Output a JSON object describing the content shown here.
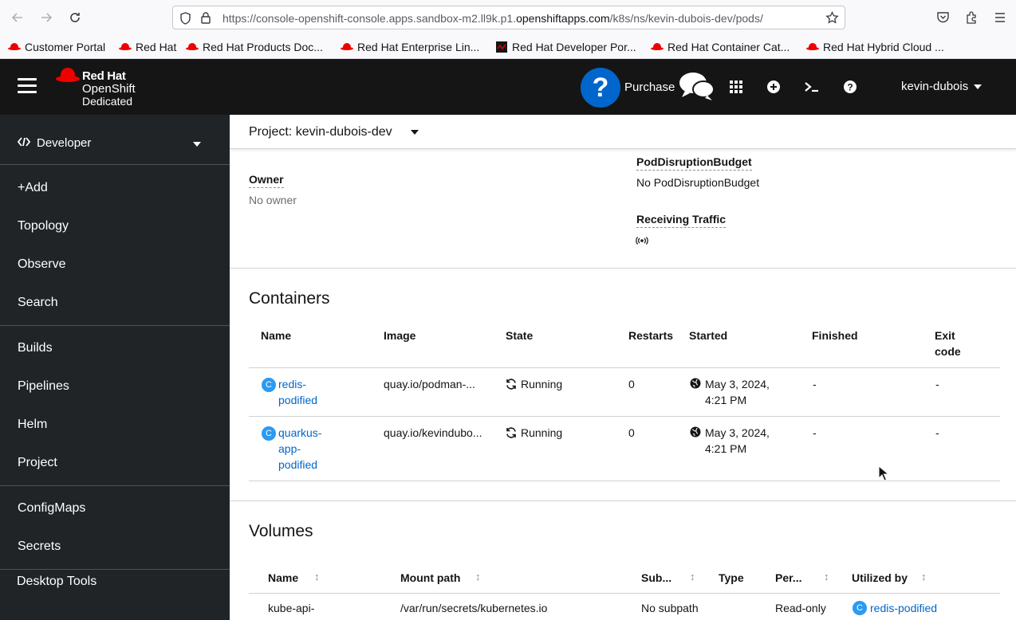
{
  "browser": {
    "url_prefix": "https://console-openshift-console.apps.sandbox-m2.ll9k.p1.",
    "url_domain": "openshiftapps.com",
    "url_suffix": "/k8s/ns/kevin-dubois-dev/pods/",
    "bookmarks": [
      {
        "label": "Customer Portal"
      },
      {
        "label": "Red Hat"
      },
      {
        "label": "Red Hat Products Doc..."
      },
      {
        "label": "Red Hat Enterprise Lin..."
      },
      {
        "label": "Red Hat Developer Por..."
      },
      {
        "label": "Red Hat Container Cat..."
      },
      {
        "label": "Red Hat Hybrid Cloud ..."
      }
    ]
  },
  "masthead": {
    "logo_line1": "Red Hat",
    "logo_line2": "OpenShift",
    "logo_line3": "Dedicated",
    "help_glyph": "?",
    "purchase_label": "Purchase",
    "user": "kevin-dubois"
  },
  "sidebar": {
    "perspective": "Developer",
    "items": [
      {
        "label": "+Add"
      },
      {
        "label": "Topology"
      },
      {
        "label": "Observe"
      },
      {
        "label": "Search"
      },
      {
        "label": "Builds"
      },
      {
        "label": "Pipelines"
      },
      {
        "label": "Helm"
      },
      {
        "label": "Project"
      },
      {
        "label": "ConfigMaps"
      },
      {
        "label": "Secrets"
      },
      {
        "label": "Desktop Tools"
      }
    ]
  },
  "project": {
    "label": "Project: kevin-dubois-dev"
  },
  "details": {
    "owner_term": "Owner",
    "owner_value": "No owner",
    "pdb_term": "PodDisruptionBudget",
    "pdb_value": "No PodDisruptionBudget",
    "traffic_term": "Receiving Traffic"
  },
  "containers": {
    "title": "Containers",
    "headers": {
      "name": "Name",
      "image": "Image",
      "state": "State",
      "restarts": "Restarts",
      "started": "Started",
      "finished": "Finished",
      "exit_l1": "Exit",
      "exit_l2": "code"
    },
    "rows": [
      {
        "badge": "C",
        "name_l1": "redis-",
        "name_l2": "podified",
        "name_l3": "",
        "image": "quay.io/podman-...",
        "state": "Running",
        "restarts": "0",
        "started_l1": "May 3, 2024,",
        "started_l2": "4:21 PM",
        "finished": "-",
        "exit_code": "-"
      },
      {
        "badge": "C",
        "name_l1": "quarkus-",
        "name_l2": "app-",
        "name_l3": "podified",
        "image": "quay.io/kevindubo...",
        "state": "Running",
        "restarts": "0",
        "started_l1": "May 3, 2024,",
        "started_l2": "4:21 PM",
        "finished": "-",
        "exit_code": "-"
      }
    ]
  },
  "volumes": {
    "title": "Volumes",
    "headers": {
      "name": "Name",
      "mount_path": "Mount path",
      "subpath": "Sub...",
      "type": "Type",
      "permissions": "Per...",
      "utilized_by": "Utilized by"
    },
    "rows": [
      {
        "name": "kube-api-",
        "mount_path": "/var/run/secrets/kubernetes.io",
        "subpath": "No subpath",
        "permissions": "Read-only",
        "badge": "C",
        "utilized_by": "redis-podified"
      }
    ]
  },
  "colors": {
    "masthead_bg": "#151515",
    "sidebar_bg": "#212427",
    "link": "#0066cc",
    "badge": "#2b9af3",
    "brand_red": "#ee0000"
  },
  "icons": [
    "back-arrow-icon",
    "forward-arrow-icon",
    "reload-icon",
    "shield-icon",
    "lock-icon",
    "star-icon",
    "pocket-icon",
    "extensions-icon",
    "app-menu-icon",
    "hamburger-icon",
    "chat-bubbles-icon",
    "app-launcher-icon",
    "plus-circle-icon",
    "terminal-icon",
    "help-icon",
    "code-icon",
    "sync-icon",
    "globe-icon",
    "signal-icon",
    "sort-icon",
    "mouse-pointer-icon"
  ]
}
